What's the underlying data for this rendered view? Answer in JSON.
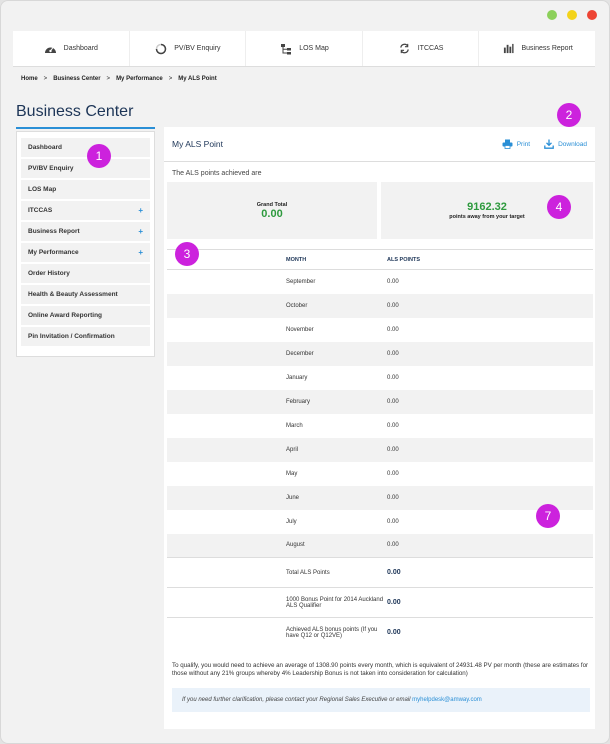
{
  "window": {
    "dots": [
      "#8cd05a",
      "#f3d31a",
      "#ed4434"
    ]
  },
  "topnav": {
    "items": [
      {
        "label": "Dashboard",
        "icon": "dashboard-gauge-icon"
      },
      {
        "label": "PV/BV Enquiry",
        "icon": "circle-progress-icon"
      },
      {
        "label": "LOS Map",
        "icon": "network-map-icon"
      },
      {
        "label": "ITCCAS",
        "icon": "refresh-icon"
      },
      {
        "label": "Business Report",
        "icon": "bar-chart-icon"
      }
    ]
  },
  "breadcrumb": {
    "items": [
      "Home",
      "Business Center",
      "My Performance",
      "My ALS Point"
    ],
    "separator": ">"
  },
  "page_title": "Business Center",
  "sidebar": {
    "items": [
      {
        "label": "Dashboard",
        "expand": ""
      },
      {
        "label": "PV/BV Enquiry",
        "expand": ""
      },
      {
        "label": "LOS Map",
        "expand": ""
      },
      {
        "label": "ITCCAS",
        "expand": "+"
      },
      {
        "label": "Business Report",
        "expand": "+"
      },
      {
        "label": "My Performance",
        "expand": "+"
      },
      {
        "label": "Order History",
        "expand": ""
      },
      {
        "label": "Health & Beauty Assessment",
        "expand": ""
      },
      {
        "label": "Online Award Reporting",
        "expand": ""
      },
      {
        "label": "Pin Invitation / Confirmation",
        "expand": ""
      }
    ]
  },
  "main": {
    "title": "My ALS Point",
    "print_label": "Print",
    "download_label": "Download",
    "intro": "The ALS points achieved are",
    "grand_total_label": "Grand Total",
    "grand_total_value": "0.00",
    "target_value": "9162.32",
    "target_label": "points away from your target",
    "table": {
      "headers": {
        "month": "MONTH",
        "points": "ALS POINTS"
      },
      "rows": [
        {
          "month": "September",
          "points": "0.00"
        },
        {
          "month": "October",
          "points": "0.00"
        },
        {
          "month": "November",
          "points": "0.00"
        },
        {
          "month": "December",
          "points": "0.00"
        },
        {
          "month": "January",
          "points": "0.00"
        },
        {
          "month": "February",
          "points": "0.00"
        },
        {
          "month": "March",
          "points": "0.00"
        },
        {
          "month": "April",
          "points": "0.00"
        },
        {
          "month": "May",
          "points": "0.00"
        },
        {
          "month": "June",
          "points": "0.00"
        },
        {
          "month": "July",
          "points": "0.00"
        },
        {
          "month": "August",
          "points": "0.00"
        }
      ],
      "summary": [
        {
          "label": "Total ALS Points",
          "value": "0.00"
        },
        {
          "label": "1000 Bonus Point for 2014 Auckland ALS Qualifier",
          "value": "0.00"
        },
        {
          "label": "Achieved ALS bonus points (If you have Q12 or Q12VE)",
          "value": "0.00"
        }
      ]
    },
    "qualify_text": "To qualify, you would need to achieve an average of 1308.90 points every month, which is equivalent of 24931.48 PV per month (these are estimates for those without any 21% groups whereby 4% Leadership Bonus is not taken into consideration for calculation)",
    "help_text": "If you need further clarification, please contact your Regional Sales Executive or email ",
    "help_email": "myhelpdesk@amway.com"
  },
  "badges": [
    "1",
    "2",
    "3",
    "4",
    "7"
  ]
}
